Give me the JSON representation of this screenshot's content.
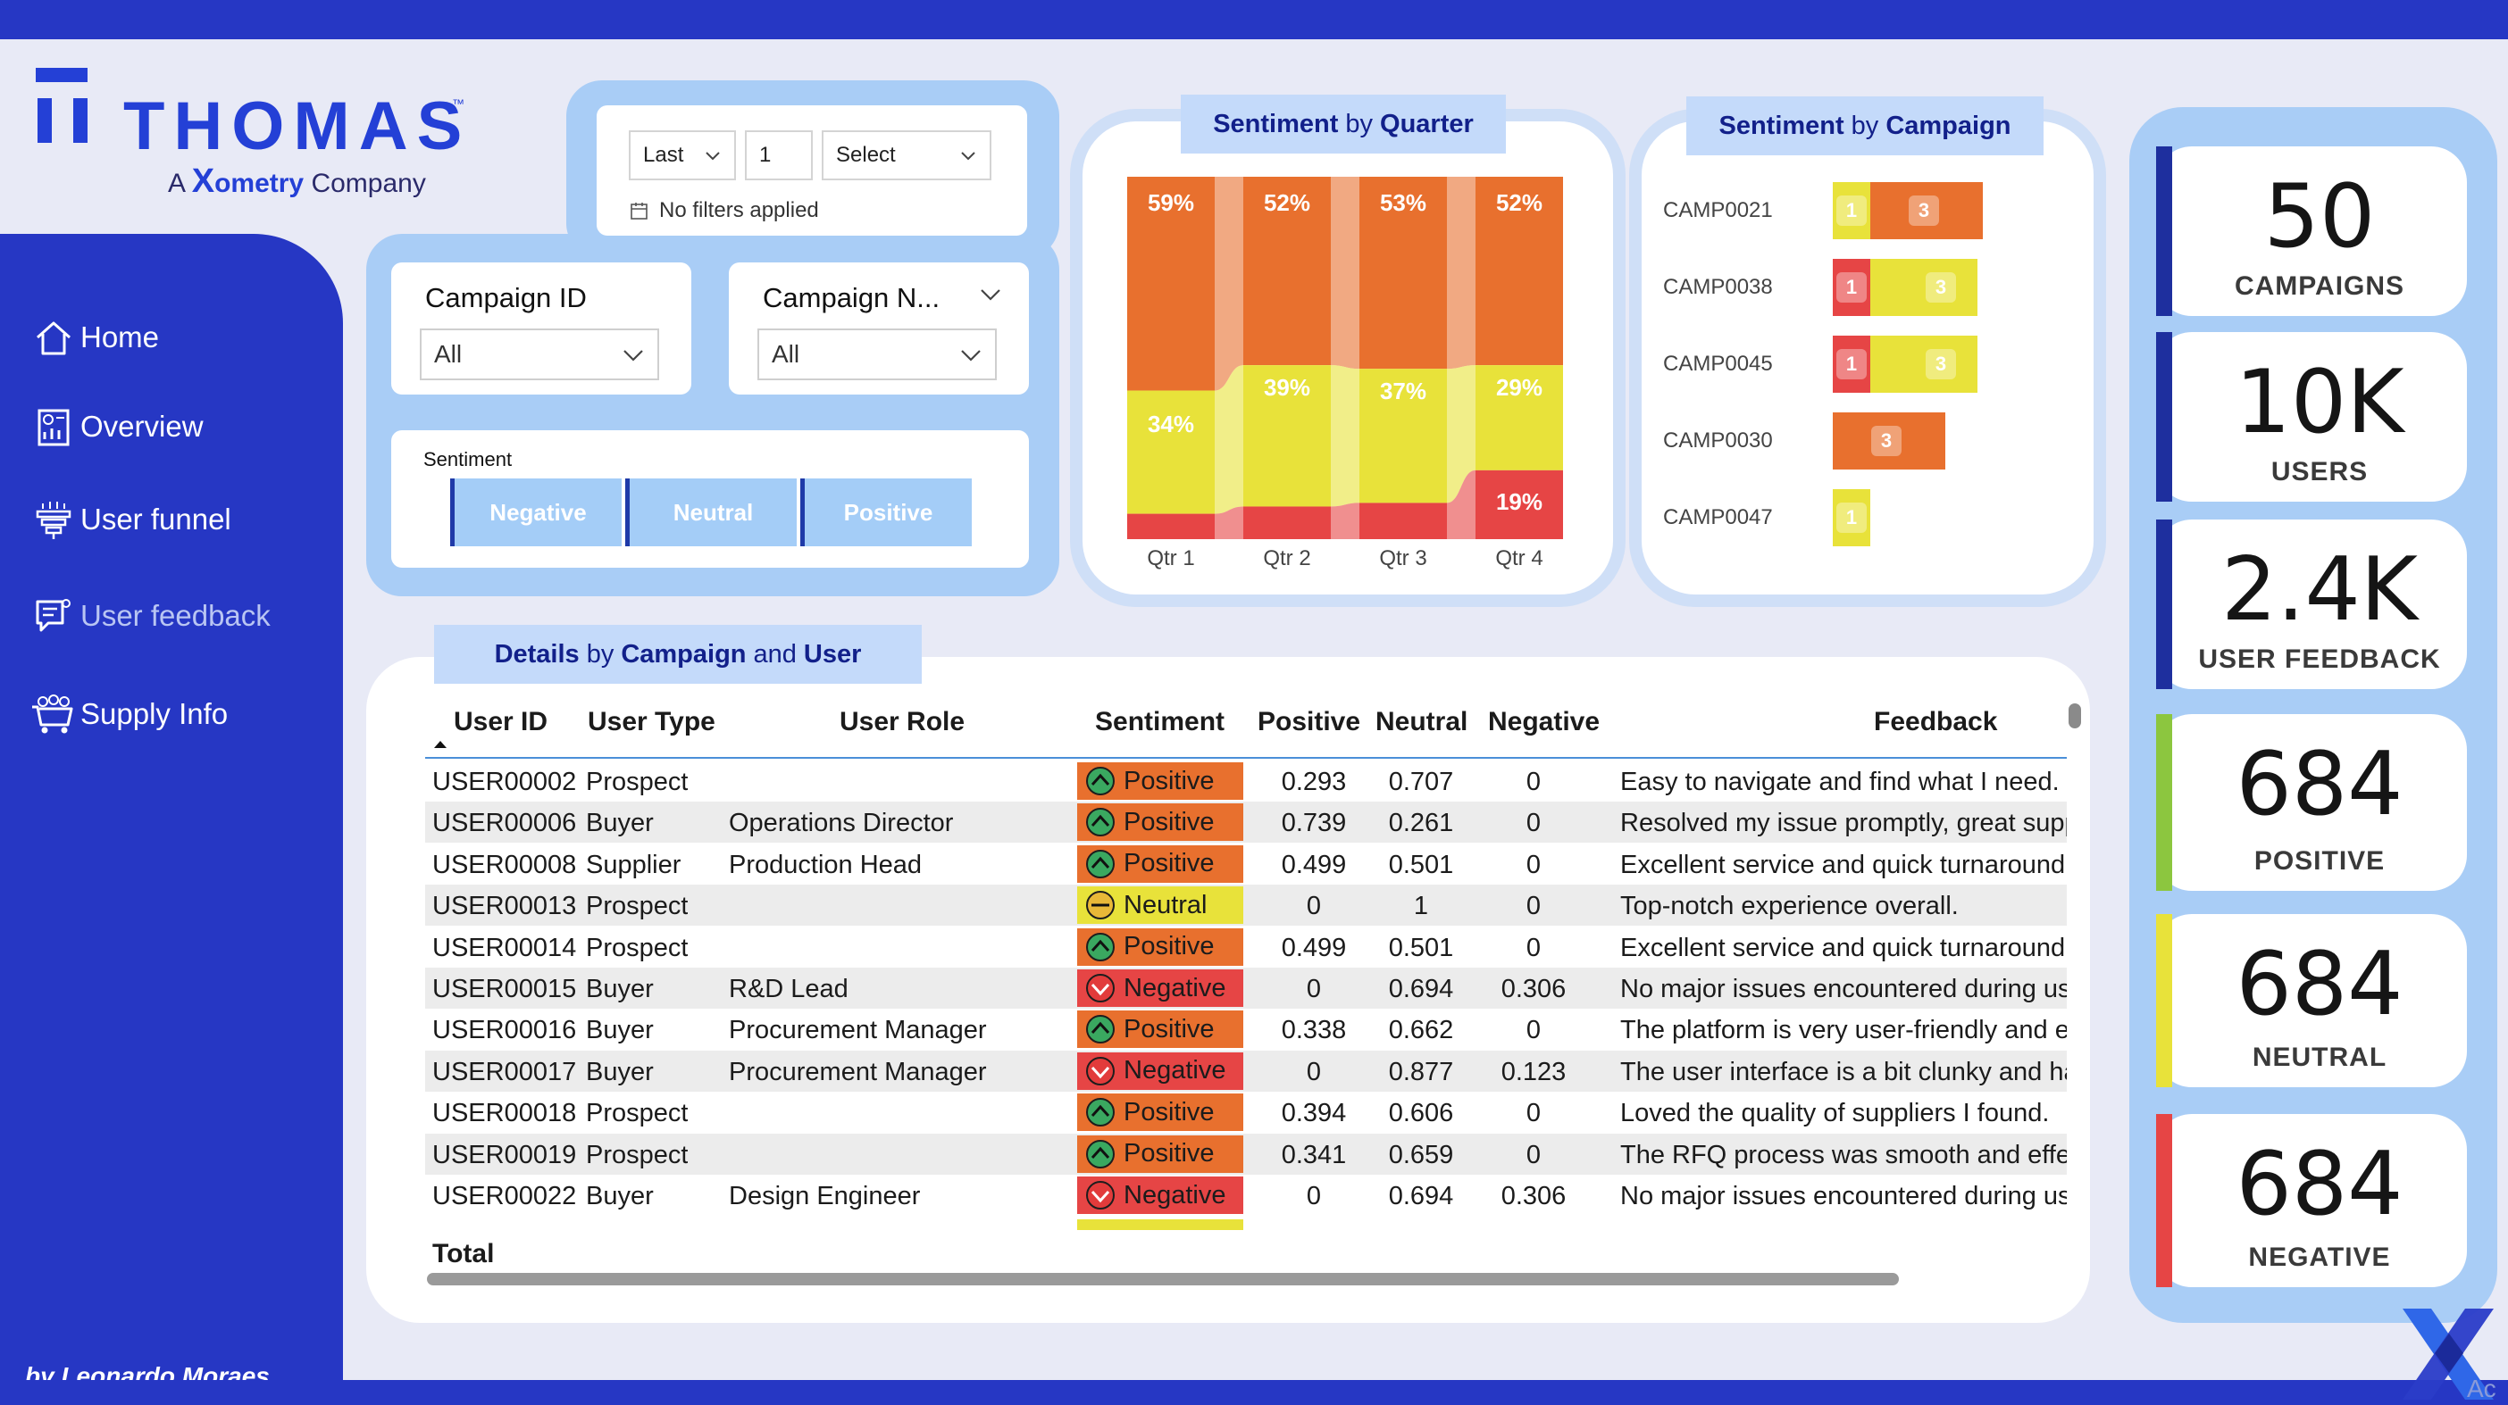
{
  "logo": {
    "brand": "THOMAS",
    "tm": "™",
    "sub_prefix": "A",
    "sub_x": "X",
    "sub_rest": "ometry",
    "sub_company": "Company"
  },
  "nav": [
    {
      "label": "Home",
      "icon": "home-icon"
    },
    {
      "label": "Overview",
      "icon": "report-icon"
    },
    {
      "label": "User funnel",
      "icon": "funnel-icon"
    },
    {
      "label": "User feedback",
      "icon": "feedback-icon"
    },
    {
      "label": "Supply Info",
      "icon": "supply-cart-icon"
    }
  ],
  "byline": "by Leonardo Moraes",
  "date_filter": {
    "period": "Last",
    "count": "1",
    "unit": "Select",
    "status": "No filters applied"
  },
  "slicers": {
    "campaign_id": {
      "title": "Campaign ID",
      "value": "All"
    },
    "campaign_name": {
      "title": "Campaign N...",
      "value": "All"
    },
    "sentiment": {
      "title": "Sentiment",
      "options": [
        "Negative",
        "Neutral",
        "Positive"
      ]
    }
  },
  "headers": {
    "quarter": {
      "bold": "Sentiment",
      "light": "by",
      "bold2": "Quarter"
    },
    "campaign": {
      "bold": "Sentiment",
      "light": "by",
      "bold2": "Campaign"
    },
    "details": {
      "bold": "Details",
      "light": "by",
      "bold2": "Campaign",
      "light2": "and",
      "bold3": "User"
    }
  },
  "colors": {
    "positive": "#e8702e",
    "neutral": "#e8e23a",
    "negative": "#e64545",
    "brand": "#2637c4",
    "kpi_panel": "#a9cdf6"
  },
  "chart_data": [
    {
      "type": "bar",
      "stacked": "100%",
      "categories": [
        "Qtr 1",
        "Qtr 2",
        "Qtr 3",
        "Qtr 4"
      ],
      "series": [
        {
          "name": "Positive",
          "values": [
            59,
            52,
            53,
            52
          ],
          "labels": [
            "59%",
            "52%",
            "53%",
            "52%"
          ]
        },
        {
          "name": "Neutral",
          "values": [
            34,
            39,
            37,
            29
          ],
          "labels": [
            "34%",
            "39%",
            "37%",
            "29%"
          ]
        },
        {
          "name": "Negative",
          "values": [
            7,
            9,
            10,
            19
          ],
          "labels": [
            "",
            "",
            "",
            "19%"
          ]
        }
      ],
      "ylim": [
        0,
        100
      ]
    },
    {
      "type": "bar",
      "orientation": "horizontal",
      "stacked": true,
      "categories": [
        "CAMP0021",
        "CAMP0038",
        "CAMP0045",
        "CAMP0030",
        "CAMP0047"
      ],
      "series": [
        {
          "name": "Negative",
          "values": [
            0,
            1,
            1,
            0,
            0
          ]
        },
        {
          "name": "Neutral",
          "values": [
            1,
            3,
            3,
            0,
            1
          ]
        },
        {
          "name": "Positive",
          "values": [
            3,
            0,
            0,
            3,
            0
          ]
        }
      ]
    }
  ],
  "kpis": [
    {
      "value": "50",
      "label": "CAMPAIGNS",
      "color": "#1e2f9e"
    },
    {
      "value": "10K",
      "label": "USERS",
      "color": "#1e2f9e"
    },
    {
      "value": "2.4K",
      "label": "USER FEEDBACK",
      "color": "#1e2f9e"
    },
    {
      "value": "684",
      "label": "POSITIVE",
      "color": "#8cc63f"
    },
    {
      "value": "684",
      "label": "NEUTRAL",
      "color": "#e8e23a"
    },
    {
      "value": "684",
      "label": "NEGATIVE",
      "color": "#e64545"
    }
  ],
  "table": {
    "columns": [
      "User ID",
      "User Type",
      "User Role",
      "Sentiment",
      "Positive",
      "Neutral",
      "Negative",
      "Feedback"
    ],
    "rows": [
      [
        "USER00002",
        "Prospect",
        "",
        "Positive",
        "0.293",
        "0.707",
        "0",
        "Easy to navigate and find what I need."
      ],
      [
        "USER00006",
        "Buyer",
        "Operations Director",
        "Positive",
        "0.739",
        "0.261",
        "0",
        "Resolved my issue promptly, great supp"
      ],
      [
        "USER00008",
        "Supplier",
        "Production Head",
        "Positive",
        "0.499",
        "0.501",
        "0",
        "Excellent service and quick turnaround!"
      ],
      [
        "USER00013",
        "Prospect",
        "",
        "Neutral",
        "0",
        "1",
        "0",
        "Top-notch experience overall."
      ],
      [
        "USER00014",
        "Prospect",
        "",
        "Positive",
        "0.499",
        "0.501",
        "0",
        "Excellent service and quick turnaround!"
      ],
      [
        "USER00015",
        "Buyer",
        "R&D Lead",
        "Negative",
        "0",
        "0.694",
        "0.306",
        "No major issues encountered during us"
      ],
      [
        "USER00016",
        "Buyer",
        "Procurement Manager",
        "Positive",
        "0.338",
        "0.662",
        "0",
        "The platform is very user-friendly and e"
      ],
      [
        "USER00017",
        "Buyer",
        "Procurement Manager",
        "Negative",
        "0",
        "0.877",
        "0.123",
        "The user interface is a bit clunky and ha"
      ],
      [
        "USER00018",
        "Prospect",
        "",
        "Positive",
        "0.394",
        "0.606",
        "0",
        "Loved the quality of suppliers I found."
      ],
      [
        "USER00019",
        "Prospect",
        "",
        "Positive",
        "0.341",
        "0.659",
        "0",
        "The RFQ process was smooth and effec"
      ],
      [
        "USER00022",
        "Buyer",
        "Design Engineer",
        "Negative",
        "0",
        "0.694",
        "0.306",
        "No major issues encountered during us"
      ]
    ],
    "total_label": "Total"
  },
  "watermark": "Ac"
}
